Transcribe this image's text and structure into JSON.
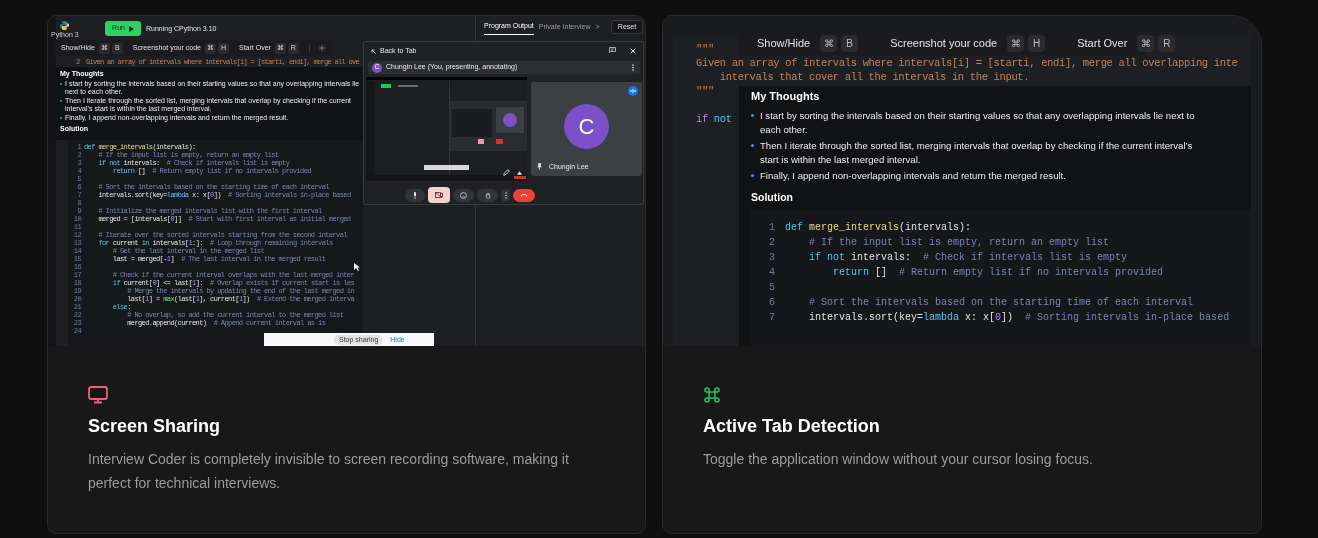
{
  "cards": [
    {
      "kind": "screen_share",
      "title": "Screen Sharing",
      "description": "Interview Coder is completely invisible to screen recording software, making it perfect for technical interviews.",
      "preview": {
        "language": "Python 3",
        "run_button": "Run",
        "runtime": "Running CPython 3.10",
        "tabs": [
          {
            "label": "Program Output",
            "selected": true
          },
          {
            "label": "Private Interview",
            "selected": false
          }
        ],
        "tabs_more": ">",
        "reset_button": "Reset",
        "prompt_line": {
          "number": "2",
          "text": "Given an array of intervals where intervals[i] = [starti, endi], merge all ove"
        },
        "shortcuts": [
          {
            "label": "Show/Hide",
            "keys": [
              "⌘",
              "B"
            ]
          },
          {
            "label": "Screenshot your code",
            "keys": [
              "⌘",
              "H"
            ]
          },
          {
            "label": "Start Over",
            "keys": [
              "⌘",
              "R"
            ]
          }
        ],
        "thoughts_title": "My Thoughts",
        "bullets": [
          "I start by sorting the intervals based on their starting values so that any overlapping intervals lie next to each other.",
          "Then I iterate through the sorted list, merging intervals that overlap by checking if the current interval’s start is within the last merged interval.",
          "Finally, I append non-overlapping intervals and return the merged result."
        ],
        "solution_title": "Solution",
        "code": [
          {
            "n": "1",
            "parts": [
              {
                "kind": "keyword",
                "text": "def "
              },
              {
                "kind": "function",
                "text": "merge_intervals"
              },
              {
                "kind": "plain",
                "text": "(intervals):"
              }
            ]
          },
          {
            "n": "2",
            "parts": [
              {
                "kind": "comment",
                "text": "    # If the input list is empty, return an empty list"
              }
            ]
          },
          {
            "n": "3",
            "parts": [
              {
                "kind": "keyword",
                "text": "    if not "
              },
              {
                "kind": "plain",
                "text": "intervals:  "
              },
              {
                "kind": "comment",
                "text": "# Check if intervals list is empty"
              }
            ]
          },
          {
            "n": "4",
            "parts": [
              {
                "kind": "keyword",
                "text": "        return "
              },
              {
                "kind": "plain",
                "text": "[]  "
              },
              {
                "kind": "comment",
                "text": "# Return empty list if no intervals provided"
              }
            ]
          },
          {
            "n": "5"
          },
          {
            "n": "6",
            "parts": [
              {
                "kind": "comment",
                "text": "    # Sort the intervals based on the starting time of each interval"
              }
            ]
          },
          {
            "n": "7",
            "parts": [
              {
                "kind": "plain",
                "text": "    intervals.sort(key="
              },
              {
                "kind": "keyword",
                "text": "lambda "
              },
              {
                "kind": "plain",
                "text": "x: x["
              },
              {
                "kind": "number",
                "text": "0"
              },
              {
                "kind": "plain",
                "text": "])  "
              },
              {
                "kind": "comment",
                "text": "# Sorting intervals in-place based"
              }
            ]
          },
          {
            "n": "8"
          },
          {
            "n": "9",
            "parts": [
              {
                "kind": "comment",
                "text": "    # Initialize the merged intervals list with the first interval"
              }
            ]
          },
          {
            "n": "10",
            "parts": [
              {
                "kind": "plain",
                "text": "    merged = [intervals["
              },
              {
                "kind": "number",
                "text": "0"
              },
              {
                "kind": "plain",
                "text": "]]  "
              },
              {
                "kind": "comment",
                "text": "# Start with first interval as initial merged"
              }
            ]
          },
          {
            "n": "11"
          },
          {
            "n": "12",
            "parts": [
              {
                "kind": "comment",
                "text": "    # Iterate over the sorted intervals starting from the second interval"
              }
            ]
          },
          {
            "n": "13",
            "parts": [
              {
                "kind": "keyword",
                "text": "    for "
              },
              {
                "kind": "plain",
                "text": "current "
              },
              {
                "kind": "keyword",
                "text": "in "
              },
              {
                "kind": "plain",
                "text": "intervals["
              },
              {
                "kind": "number",
                "text": "1"
              },
              {
                "kind": "plain",
                "text": ":]:  "
              },
              {
                "kind": "comment",
                "text": "# Loop through remaining intervals"
              }
            ]
          },
          {
            "n": "14",
            "parts": [
              {
                "kind": "comment",
                "text": "        # Get the last interval in the merged list"
              }
            ]
          },
          {
            "n": "15",
            "parts": [
              {
                "kind": "plain",
                "text": "        last = merged[-"
              },
              {
                "kind": "number",
                "text": "1"
              },
              {
                "kind": "plain",
                "text": "]  "
              },
              {
                "kind": "comment",
                "text": "# The last interval in the merged result"
              }
            ]
          },
          {
            "n": "16"
          },
          {
            "n": "17",
            "parts": [
              {
                "kind": "comment",
                "text": "        # Check if the current interval overlaps with the last merged inter"
              }
            ]
          },
          {
            "n": "18",
            "parts": [
              {
                "kind": "keyword",
                "text": "        if "
              },
              {
                "kind": "plain",
                "text": "current["
              },
              {
                "kind": "number",
                "text": "0"
              },
              {
                "kind": "plain",
                "text": "] <= last["
              },
              {
                "kind": "number",
                "text": "1"
              },
              {
                "kind": "plain",
                "text": "]:  "
              },
              {
                "kind": "comment",
                "text": "# Overlap exists if current start is les"
              }
            ]
          },
          {
            "n": "19",
            "parts": [
              {
                "kind": "comment",
                "text": "            # Merge the intervals by updating the end of the last merged in"
              }
            ]
          },
          {
            "n": "20",
            "parts": [
              {
                "kind": "plain",
                "text": "            last["
              },
              {
                "kind": "number",
                "text": "1"
              },
              {
                "kind": "plain",
                "text": "] = "
              },
              {
                "kind": "builtin",
                "text": "max"
              },
              {
                "kind": "plain",
                "text": "(last["
              },
              {
                "kind": "number",
                "text": "1"
              },
              {
                "kind": "plain",
                "text": "], current["
              },
              {
                "kind": "number",
                "text": "1"
              },
              {
                "kind": "plain",
                "text": "])  "
              },
              {
                "kind": "comment",
                "text": "# Extend the merged interva"
              }
            ]
          },
          {
            "n": "21",
            "parts": [
              {
                "kind": "keyword",
                "text": "        else"
              },
              {
                "kind": "plain",
                "text": ":"
              }
            ]
          },
          {
            "n": "22",
            "parts": [
              {
                "kind": "comment",
                "text": "            # No overlap, so add the current interval to the merged list"
              }
            ]
          },
          {
            "n": "23",
            "parts": [
              {
                "kind": "plain",
                "text": "            merged.append(current)  "
              },
              {
                "kind": "comment",
                "text": "# Append current interval as is"
              }
            ]
          },
          {
            "n": "24"
          }
        ],
        "call": {
          "back_button": "Back to Tab",
          "presenter_initial": "C",
          "presenter_label": "Chungin Lee (You, presenting, annotating)",
          "tile_initial": "C",
          "tile_name": "Chungin Lee",
          "camera_off": true
        },
        "share_bar": {
          "stop_button": "Stop sharing",
          "hide_link": "Hide"
        }
      }
    },
    {
      "kind": "tab_detection",
      "title": "Active Tab Detection",
      "description": "Toggle the application window without your cursor losing focus.",
      "preview": {
        "editor_lines": [
          {
            "parts": [
              {
                "kind": "string",
                "text": "\"\"\""
              }
            ]
          },
          {
            "parts": [
              {
                "kind": "string",
                "text": "Given an array of intervals where intervals[i] = [starti, endi], merge all overlapping inte"
              }
            ]
          },
          {
            "parts": [
              {
                "kind": "string",
                "text": "    intervals that cover all the intervals in the input."
              }
            ]
          },
          {
            "parts": [
              {
                "kind": "string",
                "text": "\"\"\""
              }
            ]
          },
          {
            "parts": [
              {
                "kind": "control",
                "text": "if "
              },
              {
                "kind": "keyword",
                "text": "not"
              }
            ]
          }
        ],
        "shortcuts": [
          {
            "label": "Show/Hide",
            "keys": [
              "⌘",
              "B"
            ]
          },
          {
            "label": "Screenshot your code",
            "keys": [
              "⌘",
              "H"
            ]
          },
          {
            "label": "Start Over",
            "keys": [
              "⌘",
              "R"
            ]
          }
        ],
        "thoughts_title": "My Thoughts",
        "bullets": [
          "I start by sorting the intervals based on their starting values so that any overlapping intervals lie next to each other.",
          "Then I iterate through the sorted list, merging intervals that overlap by checking if the current interval’s start is within the last merged interval.",
          "Finally, I append non-overlapping intervals and return the merged result."
        ],
        "solution_title": "Solution",
        "code": [
          {
            "n": "1",
            "parts": [
              {
                "kind": "keyword",
                "text": "def "
              },
              {
                "kind": "function",
                "text": "merge_intervals"
              },
              {
                "kind": "plain",
                "text": "(intervals):"
              }
            ]
          },
          {
            "n": "2",
            "parts": [
              {
                "kind": "comment",
                "text": "    # If the input list is empty, return an empty list"
              }
            ]
          },
          {
            "n": "3",
            "parts": [
              {
                "kind": "keyword",
                "text": "    if not "
              },
              {
                "kind": "plain",
                "text": "intervals:  "
              },
              {
                "kind": "comment",
                "text": "# Check if intervals list is empty"
              }
            ]
          },
          {
            "n": "4",
            "parts": [
              {
                "kind": "keyword",
                "text": "        return "
              },
              {
                "kind": "plain",
                "text": "[]  "
              },
              {
                "kind": "comment",
                "text": "# Return empty list if no intervals provided"
              }
            ]
          },
          {
            "n": "5"
          },
          {
            "n": "6",
            "parts": [
              {
                "kind": "comment",
                "text": "    # Sort the intervals based on the starting time of each interval"
              }
            ]
          },
          {
            "n": "7",
            "parts": [
              {
                "kind": "plain",
                "text": "    intervals.sort(key="
              },
              {
                "kind": "keyword",
                "text": "lambda "
              },
              {
                "kind": "plain",
                "text": "x: x["
              },
              {
                "kind": "number",
                "text": "0"
              },
              {
                "kind": "plain",
                "text": "])  "
              },
              {
                "kind": "comment",
                "text": "# Sorting intervals in-place based"
              }
            ]
          }
        ]
      }
    }
  ]
}
